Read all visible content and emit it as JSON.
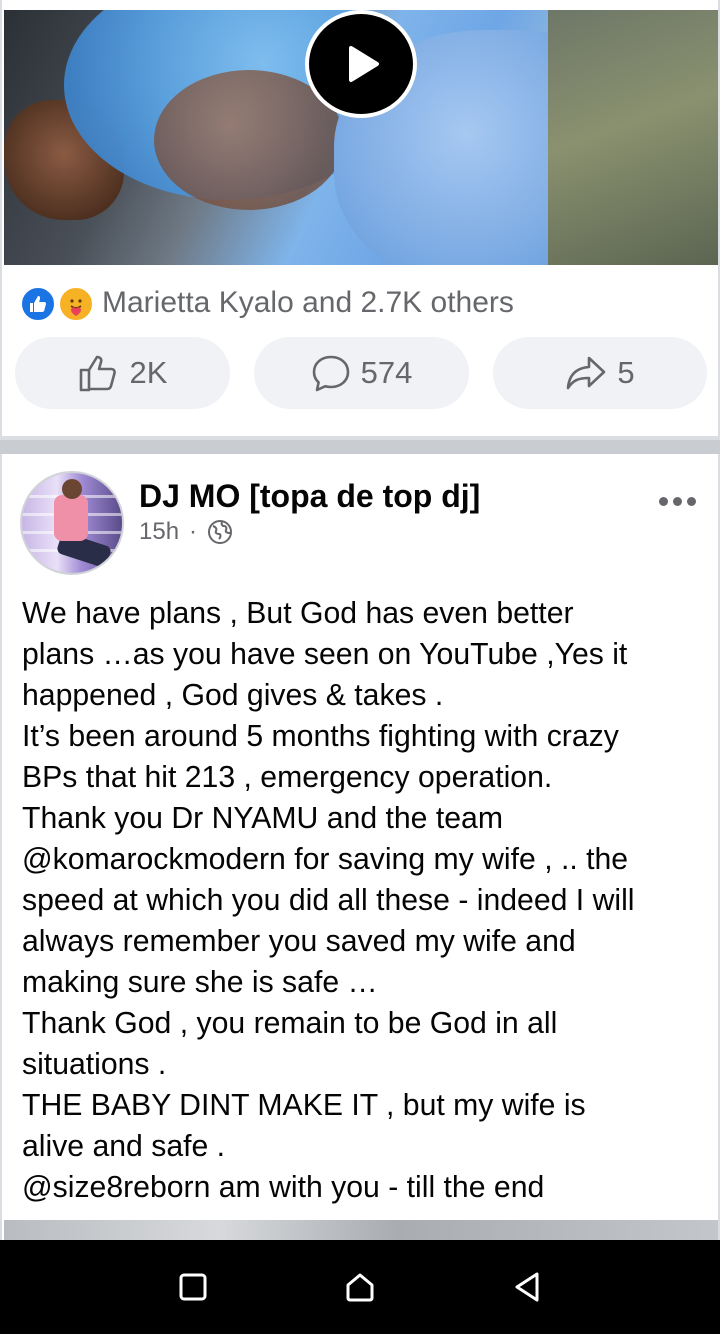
{
  "post1": {
    "reactions_text": "Marietta Kyalo and 2.7K others",
    "reaction_icons": [
      "like-reaction-icon",
      "care-reaction-icon"
    ],
    "like_count": "2K",
    "comment_count": "574",
    "share_count": "5"
  },
  "post2": {
    "author": "DJ MO [topa de top dj]",
    "time": "15h",
    "separator": "·",
    "audience_icon": "globe-icon",
    "text_lines": [
      "We have plans , But God has even better",
      "plans …as you have seen on YouTube ,Yes it",
      "happened , God gives & takes .",
      "It’s been around 5 months fighting with crazy",
      "BPs that hit 213 , emergency operation.",
      "Thank you Dr NYAMU and the team",
      "@komarockmodern for saving my wife , .. the",
      "speed at which you did all these - indeed I will",
      "always remember you saved my wife and",
      "making sure she is safe …",
      "Thank God , you remain to be God in all",
      "situations .",
      "THE BABY DINT MAKE IT , but my wife is",
      "alive and safe .",
      "@size8reborn am with you - till the end"
    ]
  },
  "colors": {
    "brand_blue": "#1b74e4",
    "secondary_text": "#65676b",
    "pill_bg": "#f0f2f5"
  }
}
